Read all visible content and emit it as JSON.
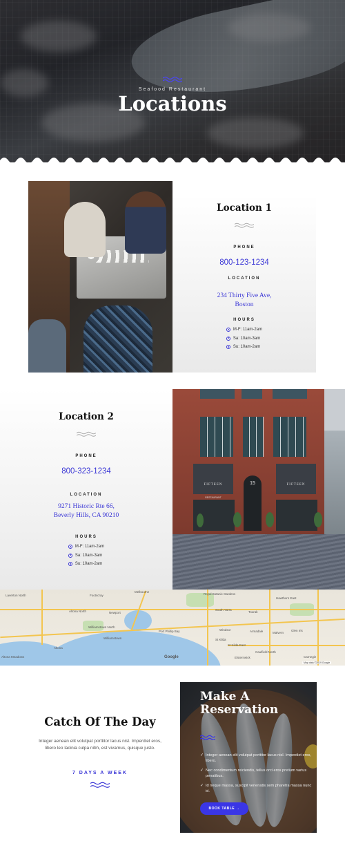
{
  "hero": {
    "subtitle": "Seafood Restaurant",
    "title": "Locations"
  },
  "locations": [
    {
      "title": "Location 1",
      "phone_label": "PHONE",
      "phone": "800-123-1234",
      "location_label": "LOCATION",
      "address_line1": "234 Thirty Five Ave,",
      "address_line2": "Boston",
      "hours_label": "HOURS",
      "hours": [
        "M-F: 11am-2am",
        "Sa: 10am-3am",
        "Su: 10am-2am"
      ]
    },
    {
      "title": "Location 2",
      "phone_label": "PHONE",
      "phone": "800-323-1234",
      "location_label": "LOCATION",
      "address_line1": "9271 Historic Rte 66,",
      "address_line2": "Beverly Hills, CA 90210",
      "hours_label": "HOURS",
      "hours": [
        "M-F: 11am-2am",
        "Sa: 10am-3am",
        "Su: 10am-2am"
      ]
    }
  ],
  "storefront": {
    "sign_left": "FIFTEEN",
    "sign_right": "FIFTEEN",
    "number": "15",
    "restaurant": "RESTAURANT"
  },
  "map": {
    "labels": [
      "Laverton North",
      "Footscray",
      "Melbourne",
      "Royal Botanic Gardens",
      "Hawthorn East",
      "Altona North",
      "Newport",
      "South Yarra",
      "Toorak",
      "Williamstown North",
      "Williamstown",
      "Port Phillip Bay",
      "Windsor",
      "Armadale",
      "Malvern",
      "Glen Iris",
      "Altona",
      "St Kilda",
      "St Kilda East",
      "Caulfield North",
      "Altona Meadows",
      "Elsternwick",
      "Carnegie"
    ],
    "google": "Google",
    "attribution": "Map data ©2019 Google"
  },
  "catch": {
    "title": "Catch Of The Day",
    "text": "Integer aenean elit volutpat porttitor lacus nisl. Imperdiet eros, libero leo lacinia culpa nibh, est vivamus, quisque justo.",
    "days": "7 DAYS A WEEK"
  },
  "reservation": {
    "title_line1": "Make A",
    "title_line2": "Reservation",
    "items": [
      "Integer aenean elit volutpat porttitor lacus nisl. Imperdiet eros, libero.",
      "Nec condimentum reiciendis, tellus orci eros pretium varius penatibus.",
      "Id neque massa, suscipit venenatis sem pharetra massa nunc id."
    ],
    "button": "BOOK TABLE →"
  },
  "colors": {
    "accent": "#3a36d6",
    "button": "#3a36e6"
  }
}
